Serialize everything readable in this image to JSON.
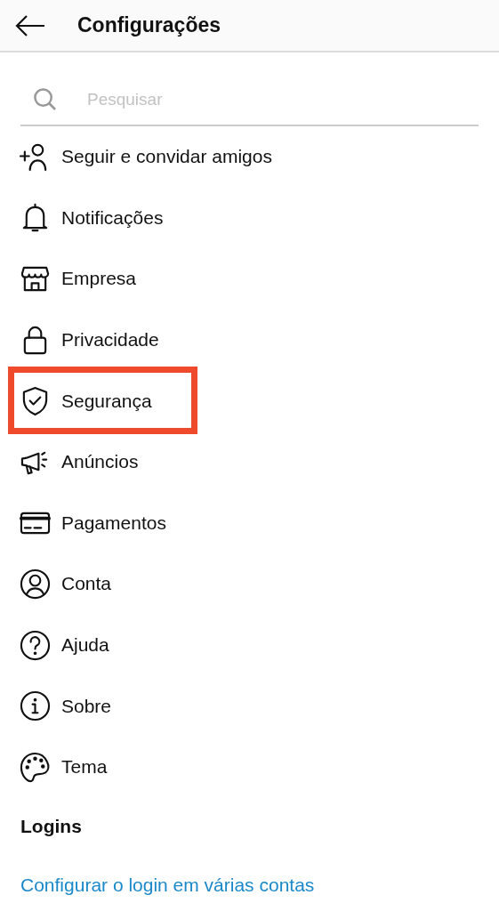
{
  "header": {
    "title": "Configurações"
  },
  "search": {
    "placeholder": "Pesquisar"
  },
  "items": [
    {
      "kind": "add-person",
      "label": "Seguir e convidar amigos",
      "highlighted": false
    },
    {
      "kind": "bell",
      "label": "Notificações",
      "highlighted": false
    },
    {
      "kind": "shop",
      "label": "Empresa",
      "highlighted": false
    },
    {
      "kind": "lock",
      "label": "Privacidade",
      "highlighted": false
    },
    {
      "kind": "shield",
      "label": "Segurança",
      "highlighted": true
    },
    {
      "kind": "megaphone",
      "label": "Anúncios",
      "highlighted": false
    },
    {
      "kind": "card",
      "label": "Pagamentos",
      "highlighted": false
    },
    {
      "kind": "person-circle",
      "label": "Conta",
      "highlighted": false
    },
    {
      "kind": "question",
      "label": "Ajuda",
      "highlighted": false
    },
    {
      "kind": "info",
      "label": "Sobre",
      "highlighted": false
    },
    {
      "kind": "palette",
      "label": "Tema",
      "highlighted": false
    }
  ],
  "logins": {
    "heading": "Logins",
    "link": "Configurar o login em várias contas"
  }
}
